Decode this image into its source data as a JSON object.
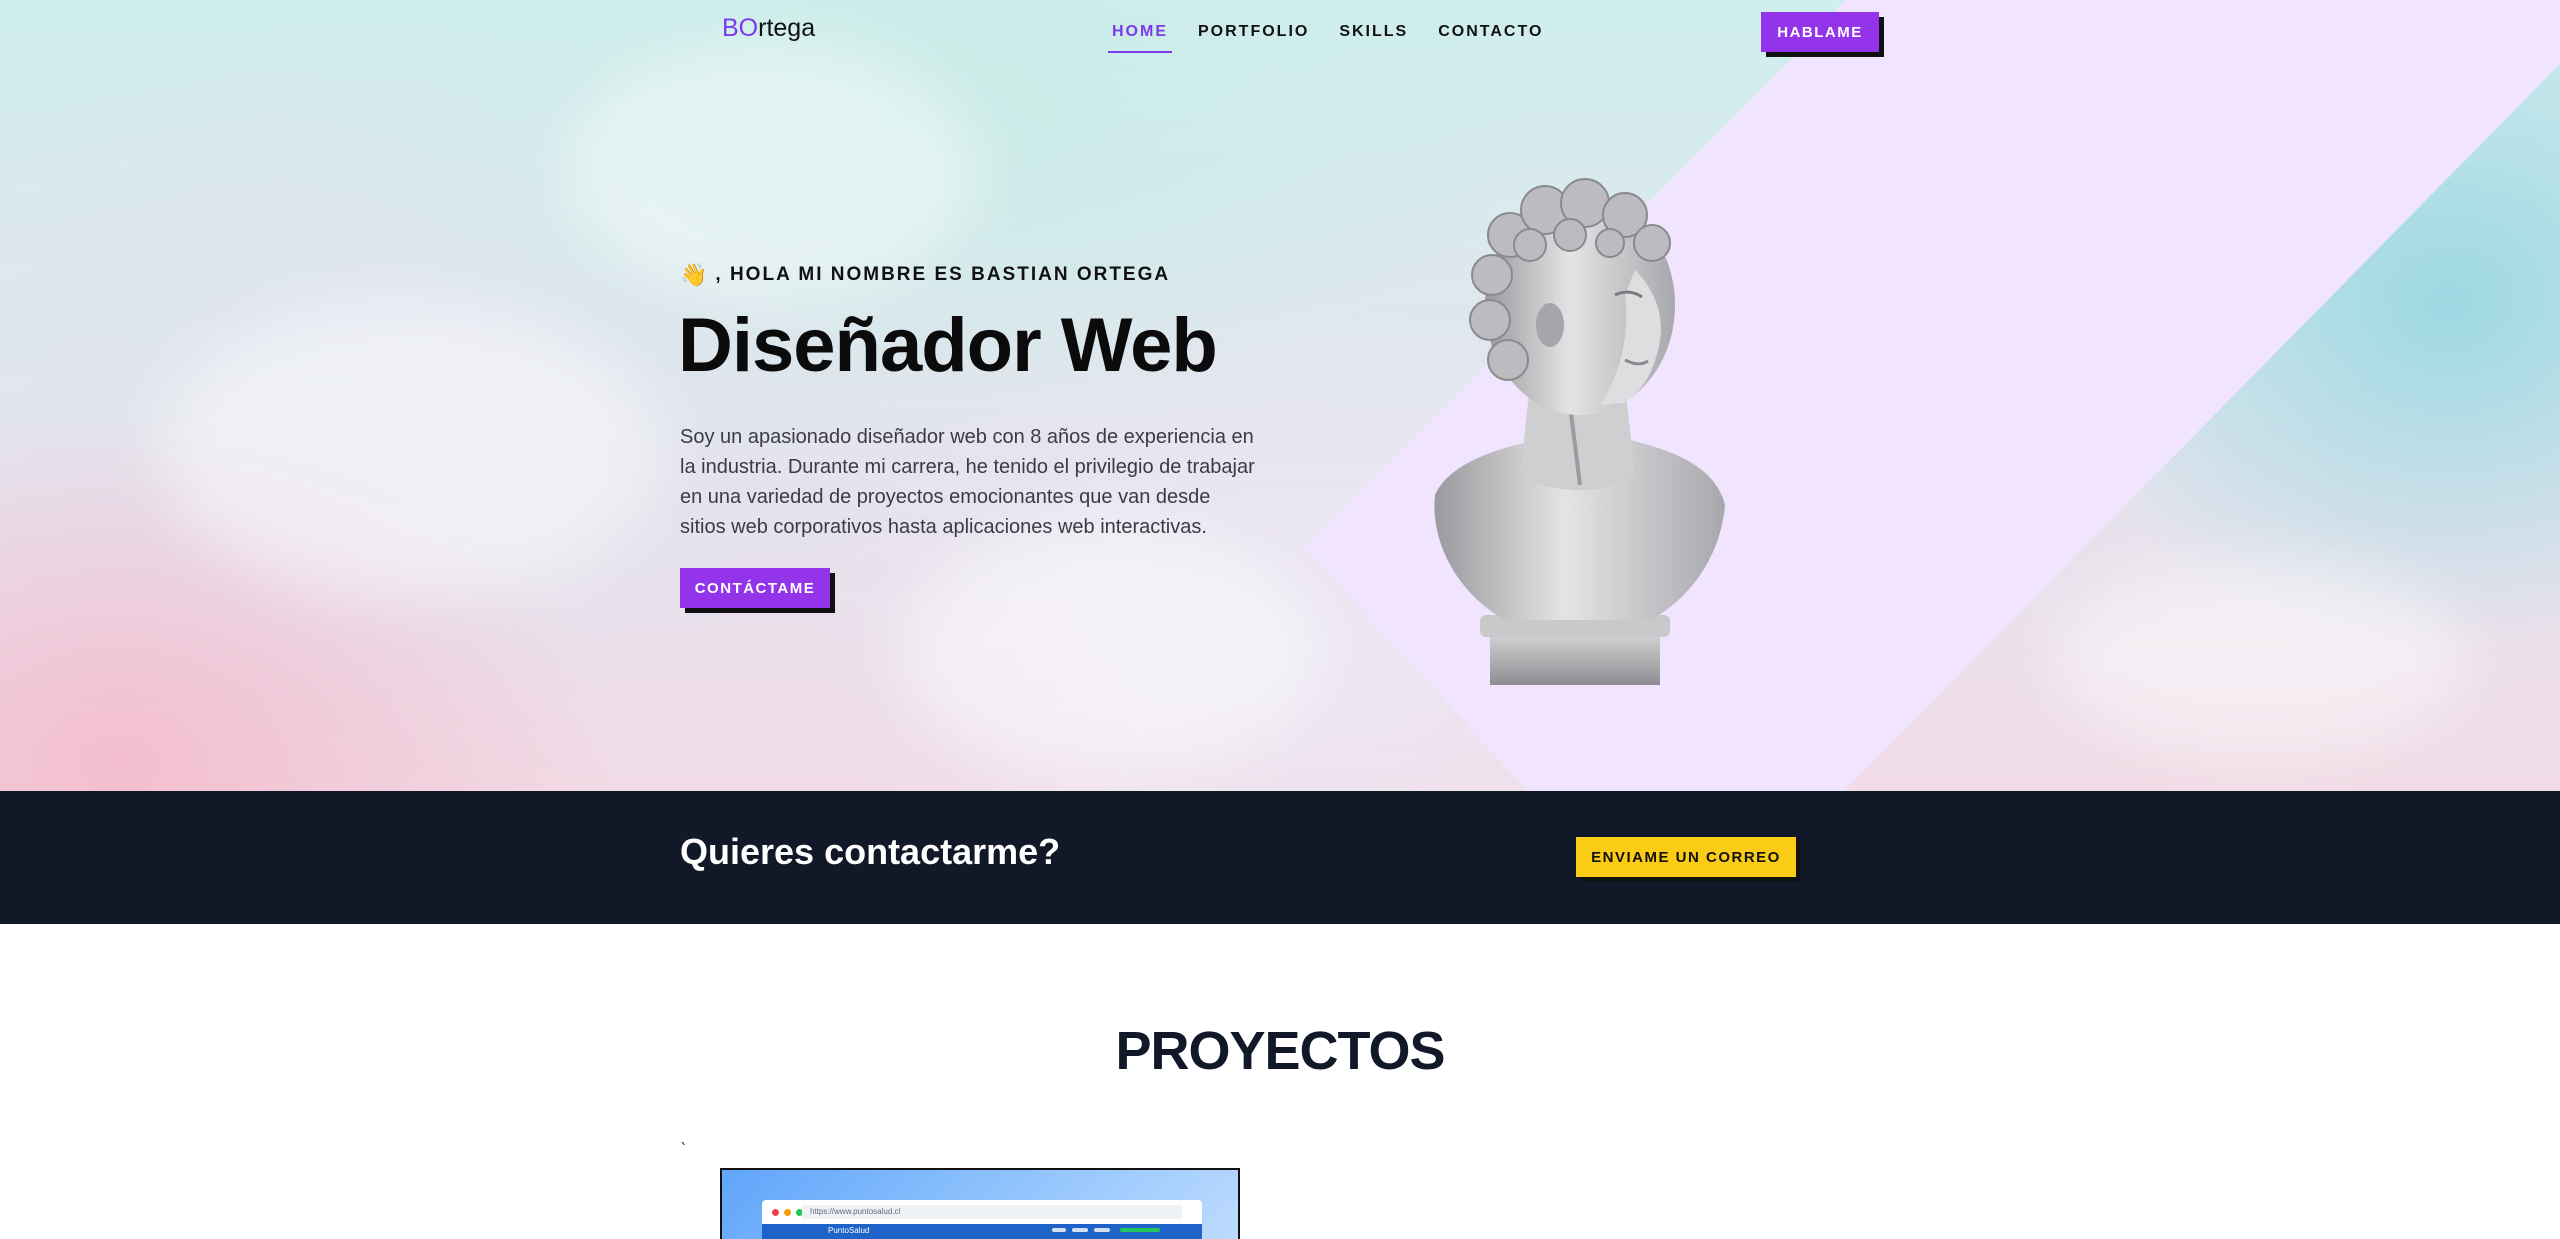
{
  "nav": {
    "logo_prefix": "BO",
    "logo_suffix": "rtega",
    "links": [
      {
        "label": "HOME",
        "active": true
      },
      {
        "label": "PORTFOLIO",
        "active": false
      },
      {
        "label": "SKILLS",
        "active": false
      },
      {
        "label": "CONTACTO",
        "active": false
      }
    ],
    "cta_label": "HABLAME"
  },
  "hero": {
    "wave_emoji": "👋",
    "greeting": ", HOLA MI NOMBRE ES BASTIAN ORTEGA",
    "headline": "Diseñador Web",
    "intro": "Soy un apasionado diseñador web con 8 años de experiencia en la industria. Durante mi carrera, he tenido el privilegio de trabajar en una variedad de proyectos emocionantes que van desde sitios web corporativos hasta aplicaciones web interactivas.",
    "button_label": "CONTÁCTAME",
    "image": "david-bust-statue"
  },
  "cta": {
    "title": "Quieres contactarme?",
    "button_label": "ENVIAME UN CORREO"
  },
  "projects": {
    "title": "PROYECTOS",
    "tick": "`",
    "preview_url": "https://www.puntosalud.cl",
    "preview_brand": "PuntoSalud"
  },
  "colors": {
    "accent": "#9333ea",
    "accent_text": "#7c3aed",
    "dark": "#111827",
    "yellow": "#facc15",
    "lavender": "#f0e4ff"
  }
}
